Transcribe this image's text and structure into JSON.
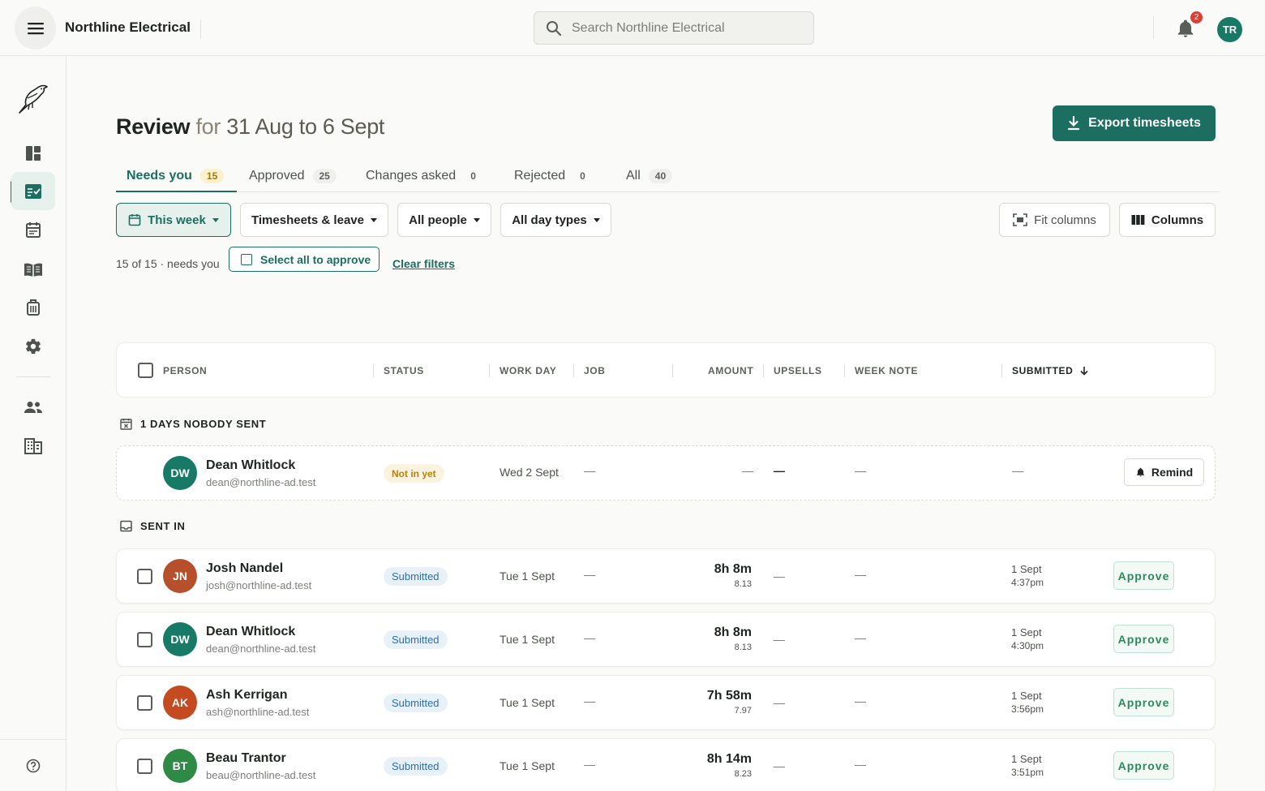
{
  "header": {
    "app_name": "Northline Electrical",
    "search_placeholder": "Search Northline Electrical",
    "notification_count": "2",
    "user_initials": "TR"
  },
  "sidebar": {
    "icons": [
      "dashboard-icon",
      "timesheet-review-icon",
      "calendar-icon",
      "handbook-icon",
      "jobs-icon",
      "settings-icon",
      "people-icon",
      "company-icon",
      "help-icon"
    ]
  },
  "page": {
    "title_main": "Review",
    "title_for": "for",
    "title_range": "31 Aug to 6 Sept",
    "export_label": "Export timesheets"
  },
  "tabs": [
    {
      "label": "Needs you",
      "count": "15"
    },
    {
      "label": "Approved",
      "count": "25"
    },
    {
      "label": "Changes asked",
      "count": "0"
    },
    {
      "label": "Rejected",
      "count": "0"
    },
    {
      "label": "All",
      "count": "40"
    }
  ],
  "filters": {
    "week": "This week",
    "type": "Timesheets & leave",
    "people": "All people",
    "day_types": "All day types",
    "fit_columns": "Fit columns",
    "columns": "Columns"
  },
  "summary": {
    "count_text": "15 of 15 · needs you",
    "select_all": "Select all to approve",
    "clear_filters": "Clear filters"
  },
  "table": {
    "headers": {
      "person": "PERSON",
      "status": "STATUS",
      "work_day": "WORK DAY",
      "job": "JOB",
      "amount": "AMOUNT",
      "upsells": "UPSELLS",
      "week_note": "WEEK NOTE",
      "submitted": "SUBMITTED"
    }
  },
  "sections": {
    "nobody_sent": "1 DAYS NOBODY SENT",
    "sent_in": "SENT IN"
  },
  "missing_rows": [
    {
      "initials": "DW",
      "name": "Dean Whitlock",
      "email": "dean@northline-ad.test",
      "status": "Not in yet",
      "work_day": "Wed 2 Sept",
      "job": "—",
      "amount": "—",
      "upsells": "—",
      "week_note": "—",
      "submitted": "—",
      "action": "Remind",
      "avatar_color": "#167a66"
    }
  ],
  "rows": [
    {
      "initials": "JN",
      "name": "Josh Nandel",
      "email": "josh@northline-ad.test",
      "status": "Submitted",
      "work_day": "Tue 1 Sept",
      "job": "—",
      "amount": "8h 8m",
      "amount_decimal": "8.13",
      "upsells": "—",
      "week_note": "—",
      "submitted_date": "1 Sept",
      "submitted_time": "4:37pm",
      "action": "Approve",
      "avatar_color": "#b5502a"
    },
    {
      "initials": "DW",
      "name": "Dean Whitlock",
      "email": "dean@northline-ad.test",
      "status": "Submitted",
      "work_day": "Tue 1 Sept",
      "job": "—",
      "amount": "8h 8m",
      "amount_decimal": "8.13",
      "upsells": "—",
      "week_note": "—",
      "submitted_date": "1 Sept",
      "submitted_time": "4:30pm",
      "action": "Approve",
      "avatar_color": "#167a66"
    },
    {
      "initials": "AK",
      "name": "Ash Kerrigan",
      "email": "ash@northline-ad.test",
      "status": "Submitted",
      "work_day": "Tue 1 Sept",
      "job": "—",
      "amount": "7h 58m",
      "amount_decimal": "7.97",
      "upsells": "—",
      "week_note": "—",
      "submitted_date": "1 Sept",
      "submitted_time": "3:56pm",
      "action": "Approve",
      "avatar_color": "#c44a1f"
    },
    {
      "initials": "BT",
      "name": "Beau Trantor",
      "email": "beau@northline-ad.test",
      "status": "Submitted",
      "work_day": "Tue 1 Sept",
      "job": "—",
      "amount": "8h 14m",
      "amount_decimal": "8.23",
      "upsells": "—",
      "week_note": "—",
      "submitted_date": "1 Sept",
      "submitted_time": "3:51pm",
      "action": "Approve",
      "avatar_color": "#2f8a45"
    }
  ],
  "colors": {
    "brand": "#1b6e60",
    "submitted_badge": "#e8f1f8",
    "not_in_badge": "#fbf3df",
    "notification": "#d94032"
  }
}
